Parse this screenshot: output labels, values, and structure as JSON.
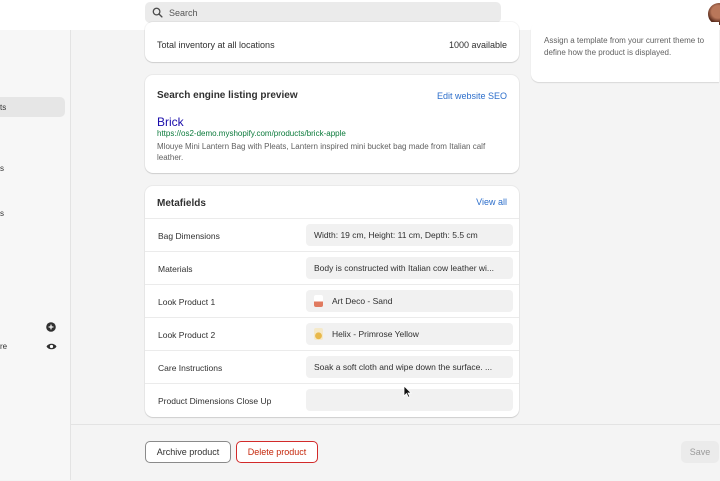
{
  "search": {
    "placeholder": "Search"
  },
  "sidebar": {
    "fragments": [
      "ts",
      "s",
      "s",
      "re"
    ]
  },
  "inventory": {
    "label": "Total inventory at all locations",
    "value": "1000 available"
  },
  "template_card": {
    "text": "Assign a template from your current theme to define how the product is displayed."
  },
  "seo": {
    "title": "Search engine listing preview",
    "edit_link": "Edit website SEO",
    "page_title": "Brick",
    "url": "https://os2-demo.myshopify.com/products/brick-apple",
    "description": "Mlouye Mini Lantern Bag with Pleats, Lantern inspired mini bucket bag made from Italian calf leather."
  },
  "metafields": {
    "title": "Metafields",
    "view_all": "View all",
    "rows": [
      {
        "label": "Bag Dimensions",
        "value": "Width: 19 cm, Height: 11 cm, Depth: 5.5 cm"
      },
      {
        "label": "Materials",
        "value": "Body is constructed with Italian cow leather wi..."
      },
      {
        "label": "Look Product 1",
        "value": "Art Deco - Sand"
      },
      {
        "label": "Look Product 2",
        "value": "Helix - Primrose Yellow"
      },
      {
        "label": "Care Instructions",
        "value": "Soak a soft cloth and wipe down the surface. ..."
      },
      {
        "label": "Product Dimensions Close Up",
        "value": ""
      }
    ]
  },
  "actions": {
    "archive": "Archive product",
    "delete": "Delete product",
    "save": "Save"
  },
  "colors": {
    "link": "#2c6ecb",
    "danger": "#d22a2a",
    "seo_title": "#1a0dab",
    "seo_url": "#0b7a3b"
  }
}
